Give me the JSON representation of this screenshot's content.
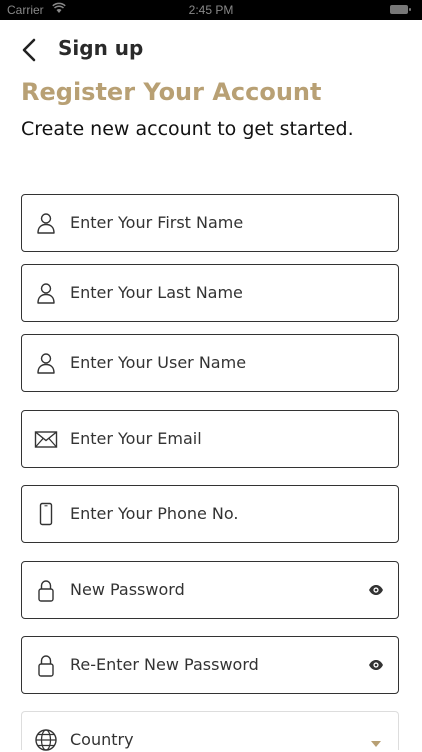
{
  "status_bar": {
    "carrier": "Carrier",
    "time": "2:45 PM"
  },
  "nav": {
    "title": "Sign up"
  },
  "header": {
    "title": "Register Your Account",
    "subtitle": "Create new account to get started."
  },
  "form": {
    "first_name": {
      "placeholder": "Enter Your First Name",
      "icon": "user-icon"
    },
    "last_name": {
      "placeholder": "Enter Your Last Name",
      "icon": "user-icon"
    },
    "user_name": {
      "placeholder": "Enter Your User Name",
      "icon": "user-icon"
    },
    "email": {
      "placeholder": "Enter Your Email",
      "icon": "envelope-icon"
    },
    "phone": {
      "placeholder": "Enter Your Phone No.",
      "icon": "phone-icon"
    },
    "new_password": {
      "placeholder": "New Password",
      "icon": "lock-icon"
    },
    "reenter_password": {
      "placeholder": "Re-Enter New Password",
      "icon": "lock-icon"
    },
    "country": {
      "placeholder": "Country",
      "icon": "globe-icon"
    }
  },
  "colors": {
    "accent": "#b8a074",
    "text": "#222222",
    "border": "#333333"
  }
}
